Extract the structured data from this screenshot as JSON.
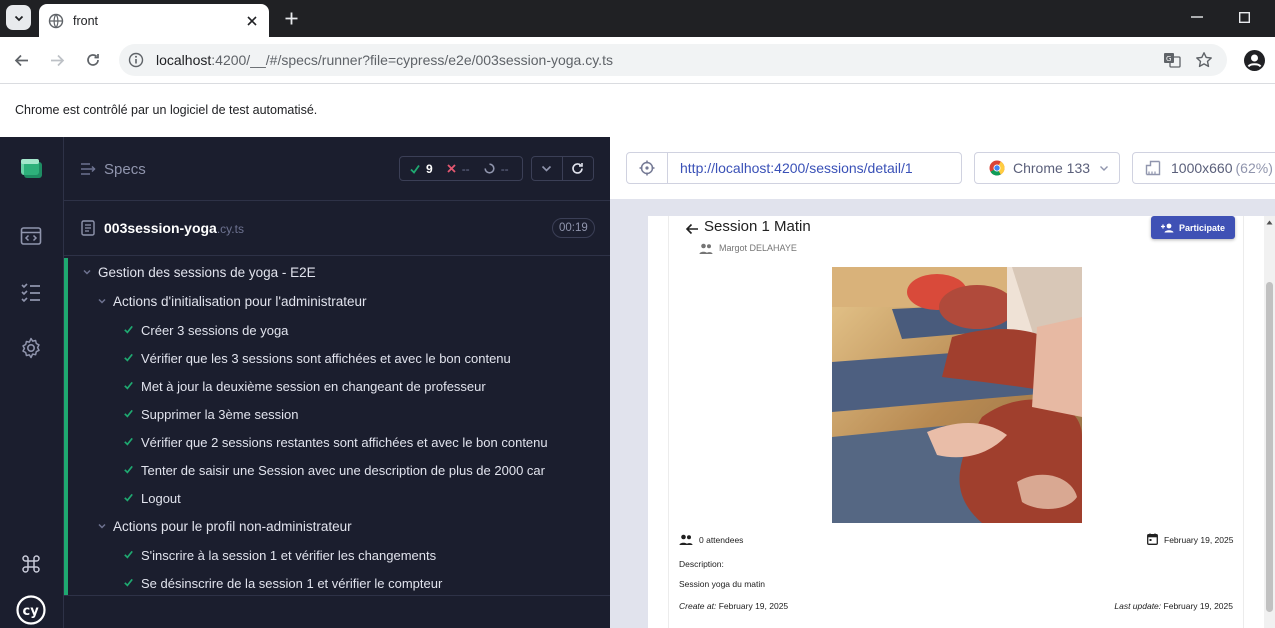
{
  "browser": {
    "tab_title": "front",
    "url_host": "localhost",
    "url_rest": ":4200/__/#/specs/runner?file=cypress/e2e/003session-yoga.cy.ts",
    "automation_banner": "Chrome est contrôlé par un logiciel de test automatisé."
  },
  "reporter": {
    "specs_label": "Specs",
    "passed": "9",
    "failed": "--",
    "pending": "--",
    "spec_name": "003session-yoga",
    "spec_ext": ".cy.ts",
    "duration": "00:19",
    "tests": [
      {
        "kind": "suite",
        "level": 0,
        "label": "Gestion des sessions de yoga - E2E"
      },
      {
        "kind": "suite",
        "level": 1,
        "label": "Actions d'initialisation pour l'administrateur"
      },
      {
        "kind": "test",
        "level": 2,
        "label": "Créer 3 sessions de yoga"
      },
      {
        "kind": "test",
        "level": 2,
        "label": "Vérifier que les 3 sessions sont affichées et avec le bon contenu"
      },
      {
        "kind": "test",
        "level": 2,
        "label": "Met à jour la deuxième session en changeant de professeur"
      },
      {
        "kind": "test",
        "level": 2,
        "label": "Supprimer la 3ème session"
      },
      {
        "kind": "test",
        "level": 2,
        "label": "Vérifier que 2 sessions restantes sont affichées et avec le bon contenu"
      },
      {
        "kind": "test",
        "level": 2,
        "label": "Tenter de saisir une Session avec une description de plus de 2000 car"
      },
      {
        "kind": "test",
        "level": 2,
        "label": "Logout"
      },
      {
        "kind": "suite",
        "level": 1,
        "label": "Actions pour le profil non-administrateur"
      },
      {
        "kind": "test",
        "level": 2,
        "label": "S'inscrire à la session 1 et vérifier les changements"
      },
      {
        "kind": "test",
        "level": 2,
        "label": "Se désinscrire de la session 1 et vérifier le compteur"
      }
    ]
  },
  "aut": {
    "url": "http://localhost:4200/sessions/detail/1",
    "browser_name": "Chrome 133",
    "viewport": "1000x660",
    "scale": "(62%)"
  },
  "app": {
    "session_title": "Session 1 Matin",
    "teacher": "Margot DELAHAYE",
    "participate_label": "Participate",
    "attendees": "0 attendees",
    "session_date": "February 19, 2025",
    "description_label": "Description:",
    "description": "Session yoga du matin",
    "created_label": "Create at:",
    "created_date": "February 19, 2025",
    "updated_label": "Last update:",
    "updated_date": "February 19, 2025"
  },
  "colors": {
    "cypress_bg": "#1b1e2e",
    "pass_green": "#1fa971",
    "material_indigo": "#3f51b5"
  }
}
